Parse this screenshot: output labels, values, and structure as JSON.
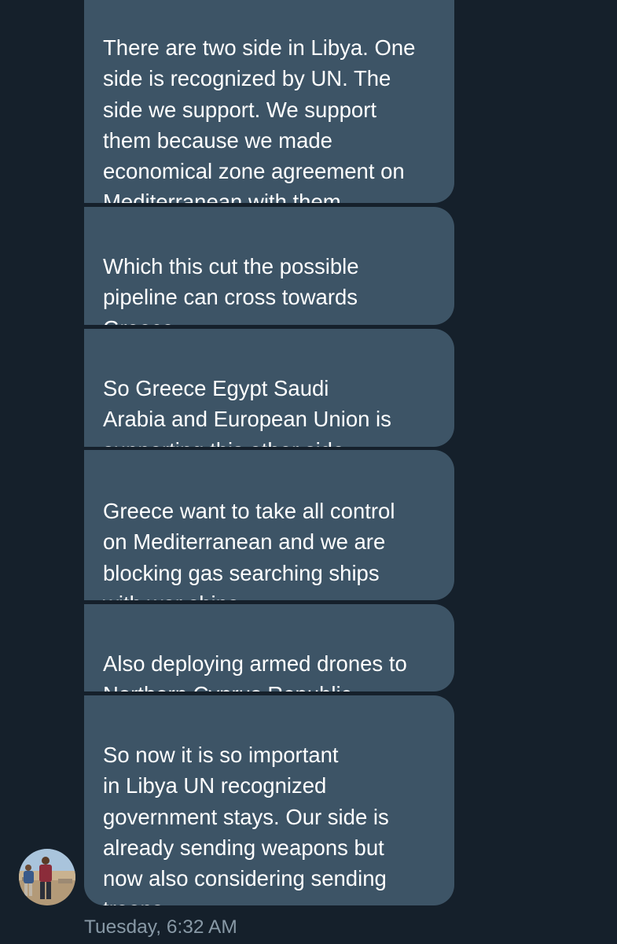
{
  "conversation": {
    "messages": [
      {
        "text": "There are two side in Libya. One\nside is recognized by UN. The\nside we support. We support\nthem because we made\neconomical zone agreement on\nMediterranean with them"
      },
      {
        "text": "Which this cut the possible\npipeline can cross towards\nGreece"
      },
      {
        "text": "So Greece Egypt Saudi\nArabia and European Union is\nsupporting this other side"
      },
      {
        "text": "Greece want to take all control\non Mediterranean and we are\nblocking gas searching ships\nwith war ships"
      },
      {
        "text": "Also deploying armed drones to\nNorthern Cyprus Republic"
      },
      {
        "text": "So now it is so important\nin Libya UN recognized\ngovernment stays. Our side is\nalready sending weapons but\nnow also considering sending\ntroops"
      }
    ],
    "timestamp": "Tuesday, 6:32 AM"
  },
  "theme": {
    "background": "#15202b",
    "bubble_color": "#3d5466",
    "text_color": "#ffffff",
    "timestamp_color": "#8899a6"
  },
  "sender": {
    "avatar_icon": "user-avatar-photo"
  }
}
